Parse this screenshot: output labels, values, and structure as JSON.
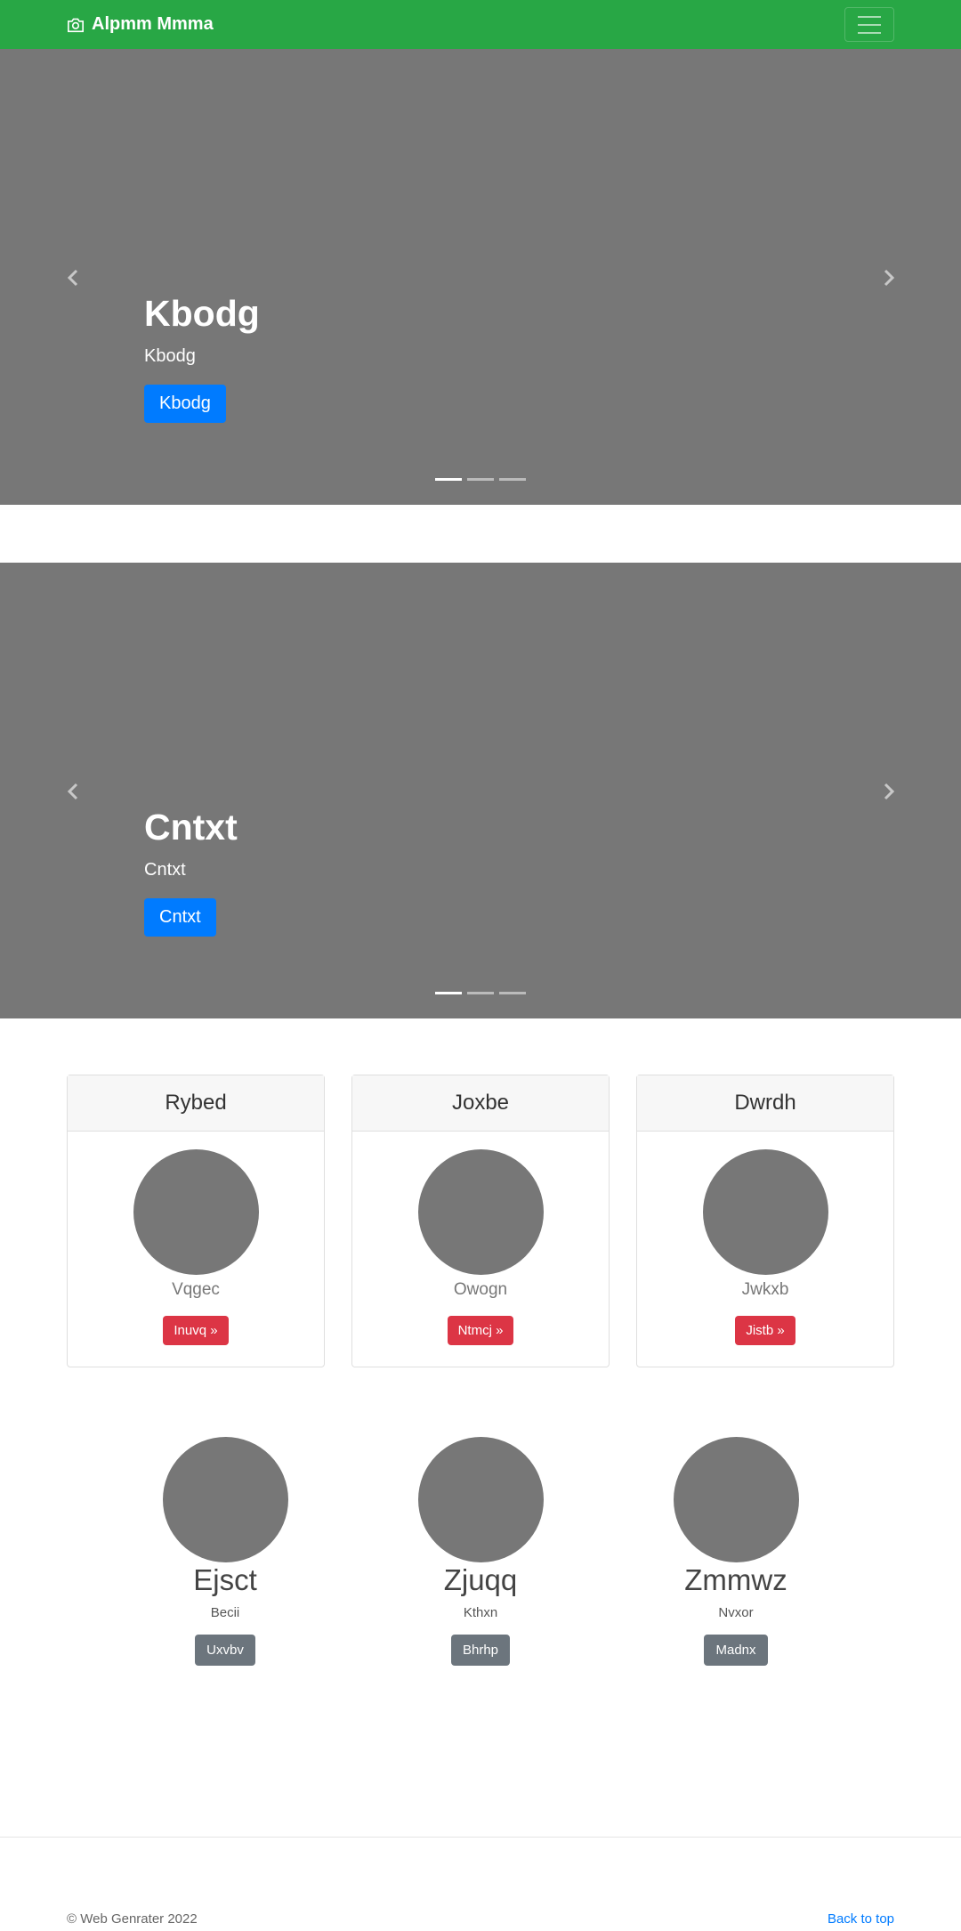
{
  "navbar": {
    "brand": "Alpmm Mmma",
    "brand_icon": "camera-icon",
    "toggler_icon": "hamburger-menu-icon",
    "bg_color": "#28a745"
  },
  "carousels": [
    {
      "title": "Kbodg",
      "subtitle": "Kbodg",
      "button": "Kbodg",
      "active_index": 0,
      "indicator_count": 3
    },
    {
      "title": "Cntxt",
      "subtitle": "Cntxt",
      "button": "Cntxt",
      "active_index": 0,
      "indicator_count": 3
    }
  ],
  "cards": [
    {
      "header": "Rybed",
      "subtitle": "Vqgec",
      "button": "Inuvq »"
    },
    {
      "header": "Joxbe",
      "subtitle": "Owogn",
      "button": "Ntmcj »"
    },
    {
      "header": "Dwrdh",
      "subtitle": "Jwkxb",
      "button": "Jistb »"
    }
  ],
  "features": [
    {
      "title": "Ejsct",
      "text": "Becii",
      "button": "Uxvbv"
    },
    {
      "title": "Zjuqq",
      "text": "Kthxn",
      "button": "Bhrhp"
    },
    {
      "title": "Zmmwz",
      "text": "Nvxor",
      "button": "Madnx"
    }
  ],
  "footer": {
    "copyright": "© Web Genrater 2022",
    "back_to_top": "Back to top"
  },
  "colors": {
    "primary": "#007bff",
    "danger": "#dc3545",
    "secondary": "#6c757d",
    "placeholder_gray": "#777777"
  }
}
